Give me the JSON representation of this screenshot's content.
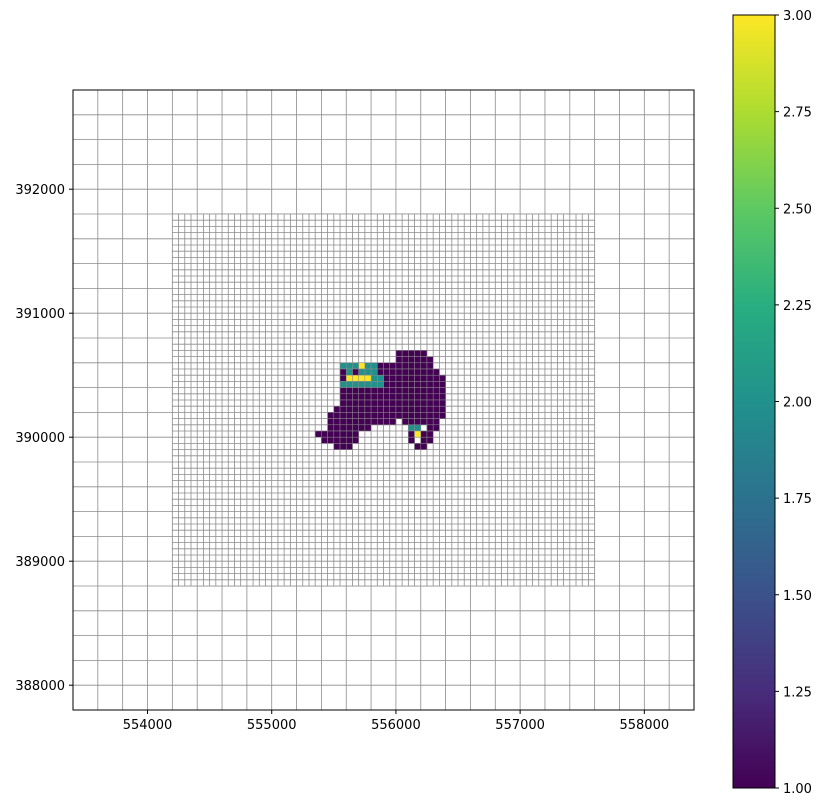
{
  "chart_data": {
    "type": "heatmap",
    "title": "",
    "xlabel": "",
    "ylabel": "",
    "xlim": [
      553400,
      558400
    ],
    "ylim": [
      387800,
      392800
    ],
    "x_ticks": [
      554000,
      555000,
      556000,
      557000,
      558000
    ],
    "y_ticks": [
      388000,
      389000,
      390000,
      391000,
      392000
    ],
    "colormap": "viridis",
    "colorbar": {
      "range": [
        1.0,
        3.0
      ],
      "ticks": [
        "1.00",
        "1.25",
        "1.50",
        "1.75",
        "2.00",
        "2.25",
        "2.50",
        "2.75",
        "3.00"
      ]
    },
    "grid": {
      "coarse": {
        "x0": 553400,
        "x1": 558400,
        "y0": 387800,
        "y1": 392800,
        "cell_size": 200,
        "color": "#8c8c8c"
      },
      "fine": {
        "x0": 554200,
        "x1": 557600,
        "y0": 388800,
        "y1": 391800,
        "cell_size": 50,
        "color": "#8c8c8c"
      }
    },
    "cell_size": 50,
    "value_rows": [
      {
        "y": 390650,
        "value": 1,
        "x_ranges": [
          [
            556000,
            556200
          ]
        ]
      },
      {
        "y": 390600,
        "value": 1,
        "x_ranges": [
          [
            556000,
            556250
          ]
        ]
      },
      {
        "y": 390550,
        "value": 1,
        "x_ranges": [
          [
            555700,
            555700
          ],
          [
            555850,
            555950
          ],
          [
            556000,
            556250
          ]
        ]
      },
      {
        "y": 390550,
        "value": 2,
        "x_ranges": [
          [
            555550,
            555650
          ],
          [
            555750,
            555800
          ]
        ]
      },
      {
        "y": 390550,
        "value": 3,
        "x_ranges": [
          [
            555700,
            555700
          ]
        ]
      },
      {
        "y": 390500,
        "value": 1,
        "x_ranges": [
          [
            555550,
            555550
          ],
          [
            555650,
            555650
          ],
          [
            555850,
            556300
          ]
        ]
      },
      {
        "y": 390500,
        "value": 2,
        "x_ranges": [
          [
            555600,
            555600
          ],
          [
            555700,
            555800
          ]
        ]
      },
      {
        "y": 390450,
        "value": 1,
        "x_ranges": [
          [
            555550,
            555550
          ],
          [
            555900,
            556350
          ]
        ]
      },
      {
        "y": 390450,
        "value": 2,
        "x_ranges": [
          [
            555800,
            555850
          ]
        ]
      },
      {
        "y": 390450,
        "value": 3,
        "x_ranges": [
          [
            555600,
            555750
          ]
        ]
      },
      {
        "y": 390400,
        "value": 1,
        "x_ranges": [
          [
            555900,
            556350
          ]
        ]
      },
      {
        "y": 390400,
        "value": 2,
        "x_ranges": [
          [
            555550,
            555850
          ]
        ]
      },
      {
        "y": 390350,
        "value": 1,
        "x_ranges": [
          [
            555550,
            556350
          ]
        ]
      },
      {
        "y": 390300,
        "value": 1,
        "x_ranges": [
          [
            555550,
            556350
          ]
        ]
      },
      {
        "y": 390250,
        "value": 1,
        "x_ranges": [
          [
            555550,
            556350
          ]
        ]
      },
      {
        "y": 390200,
        "value": 1,
        "x_ranges": [
          [
            555500,
            556350
          ]
        ]
      },
      {
        "y": 390150,
        "value": 1,
        "x_ranges": [
          [
            555450,
            556350
          ]
        ]
      },
      {
        "y": 390100,
        "value": 1,
        "x_ranges": [
          [
            555450,
            555950
          ],
          [
            556050,
            556300
          ]
        ]
      },
      {
        "y": 390050,
        "value": 1,
        "x_ranges": [
          [
            555450,
            555750
          ],
          [
            556250,
            556300
          ]
        ]
      },
      {
        "y": 390050,
        "value": 2,
        "x_ranges": [
          [
            556100,
            556150
          ]
        ]
      },
      {
        "y": 390000,
        "value": 1,
        "x_ranges": [
          [
            555350,
            555650
          ],
          [
            556100,
            556250
          ]
        ]
      },
      {
        "y": 390000,
        "value": 3,
        "x_ranges": [
          [
            556150,
            556150
          ]
        ]
      },
      {
        "y": 389950,
        "value": 1,
        "x_ranges": [
          [
            555400,
            555650
          ],
          [
            556100,
            556100
          ],
          [
            556200,
            556250
          ]
        ]
      },
      {
        "y": 389900,
        "value": 1,
        "x_ranges": [
          [
            555500,
            555600
          ],
          [
            556150,
            556200
          ]
        ]
      }
    ]
  }
}
